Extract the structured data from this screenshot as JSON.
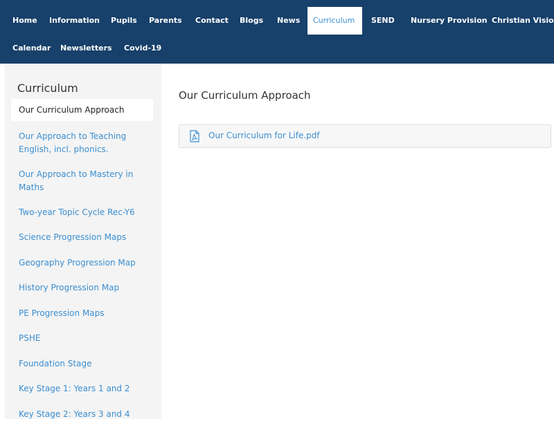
{
  "nav": {
    "row1": [
      "Home",
      "Information",
      "Pupils",
      "Parents",
      "Contact",
      "Blogs",
      "News",
      "Curriculum",
      "SEND",
      "Nursery Provision",
      "Christian Vision"
    ],
    "row2": [
      "Calendar",
      "Newsletters",
      "Covid-19"
    ]
  },
  "sidebar": {
    "title": "Curriculum",
    "items": [
      "Our Curriculum Approach",
      "Our Approach to Teaching English, incl. phonics.",
      "Our Approach to Mastery in Maths",
      "Two-year Topic Cycle Rec-Y6",
      "Science Progression Maps",
      "Geography Progression Map",
      "History Progression Map",
      "PE Progression Maps",
      "PSHE",
      "Foundation Stage",
      "Key Stage 1: Years 1 and 2",
      "Key Stage 2: Years 3 and 4"
    ]
  },
  "main": {
    "title": "Our Curriculum Approach",
    "file": {
      "label": "Our Curriculum for Life.pdf",
      "icon": "pdf-file-icon"
    }
  },
  "colors": {
    "nav_bg": "#17406a",
    "link": "#3b8ed0",
    "sidebar_bg": "#f4f4f4"
  }
}
